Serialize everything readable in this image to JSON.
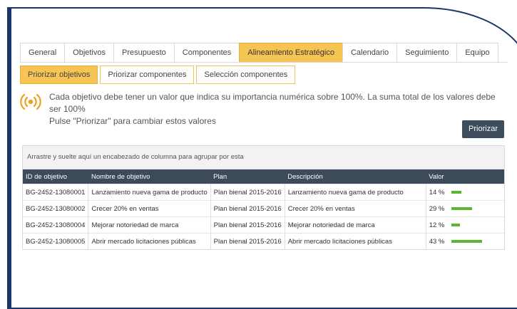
{
  "tabs": [
    {
      "label": "General",
      "active": false
    },
    {
      "label": "Objetivos",
      "active": false
    },
    {
      "label": "Presupuesto",
      "active": false
    },
    {
      "label": "Componentes",
      "active": false
    },
    {
      "label": "Alineamiento Estratégico",
      "active": true
    },
    {
      "label": "Calendario",
      "active": false
    },
    {
      "label": "Seguimiento",
      "active": false
    },
    {
      "label": "Equipo",
      "active": false
    }
  ],
  "subtabs": [
    {
      "label": "Priorizar objetivos",
      "active": true
    },
    {
      "label": "Priorizar componentes",
      "active": false
    },
    {
      "label": "Selección componentes",
      "active": false
    }
  ],
  "info": {
    "icon": "broadcast-icon",
    "line1": "Cada objetivo debe tener un valor que indica su importancia numérica sobre 100%. La suma total de los valores debe ser 100%",
    "line2": "Pulse \"Priorizar\" para cambiar estos valores"
  },
  "priorizar_label": "Priorizar",
  "grid": {
    "group_hint": "Arrastre y suelte aquí un encabezado de columna para agrupar por esta",
    "columns": [
      "ID de objetivo",
      "Nombre de objetivo",
      "Plan",
      "Descripción",
      "Valor"
    ],
    "rows": [
      {
        "id": "BG-2452-13080001",
        "name": "Lanzamiento nueva gama de producto",
        "plan": "Plan bienal 2015-2016",
        "desc": "Lanzamiento nueva gama de producto",
        "value": "14 %",
        "pct": 14
      },
      {
        "id": "BG-2452-13080002",
        "name": "Crecer 20% en ventas",
        "plan": "Plan bienal 2015-2016",
        "desc": "Crecer 20% en ventas",
        "value": "29 %",
        "pct": 29
      },
      {
        "id": "BG-2452-13080004",
        "name": "Mejorar notoriedad de marca",
        "plan": "Plan bienal 2015-2016",
        "desc": "Mejorar notoriedad de marca",
        "value": "12 %",
        "pct": 12
      },
      {
        "id": "BG-2452-13080005",
        "name": "Abrir mercado licitaciones públicas",
        "plan": "Plan bienal 2015-2016",
        "desc": "Abrir mercado licitaciones públicas",
        "value": "43 %",
        "pct": 43
      }
    ]
  },
  "colors": {
    "accent": "#f6c453",
    "header": "#3c4a59",
    "bar": "#5cb533",
    "frame": "#1c3566"
  }
}
